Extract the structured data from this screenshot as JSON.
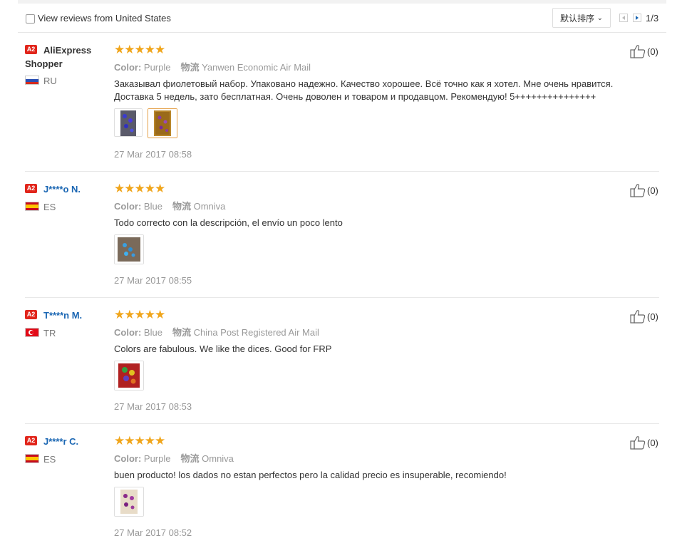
{
  "toolbar": {
    "view_country_label": "View reviews from United States",
    "sort_label": "默认排序",
    "pagination": "1/3"
  },
  "reviews": [
    {
      "badge": "A2",
      "name_line1": "AliExpress",
      "name_line2": "Shopper",
      "country": "RU",
      "rating": 5,
      "stars": "★★★★★",
      "color_label": "Color:",
      "color_value": "Purple",
      "shipping_label": "物流",
      "shipping_value": "Yanwen Economic Air Mail",
      "text": "Заказывал фиолетовый набор. Упаковано надежно. Качество хорошее. Всё точно как я хотел. Мне очень нравится. Доставка 5 недель, зато бесплатная. Очень доволен и товаром и продавцом. Рекомендую! 5+++++++++++++++",
      "date": "27 Mar 2017 08:58",
      "likes": "(0)"
    },
    {
      "badge": "A2",
      "name": "J****o N.",
      "country": "ES",
      "rating": 5,
      "stars": "★★★★★",
      "color_label": "Color:",
      "color_value": "Blue",
      "shipping_label": "物流",
      "shipping_value": "Omniva",
      "text": "Todo correcto con la descripción, el envío un poco lento",
      "date": "27 Mar 2017 08:55",
      "likes": "(0)"
    },
    {
      "badge": "A2",
      "name": "T****n M.",
      "country": "TR",
      "rating": 5,
      "stars": "★★★★★",
      "color_label": "Color:",
      "color_value": "Blue",
      "shipping_label": "物流",
      "shipping_value": "China Post Registered Air Mail",
      "text": "Colors are fabulous. We like the dices. Good for FRP",
      "date": "27 Mar 2017 08:53",
      "likes": "(0)"
    },
    {
      "badge": "A2",
      "name": "J****r C.",
      "country": "ES",
      "rating": 5,
      "stars": "★★★★★",
      "color_label": "Color:",
      "color_value": "Purple",
      "shipping_label": "物流",
      "shipping_value": "Omniva",
      "text": "buen producto! los dados no estan perfectos pero la calidad precio es insuperable, recomiendo!",
      "date": "27 Mar 2017 08:52",
      "likes": "(0)"
    }
  ]
}
